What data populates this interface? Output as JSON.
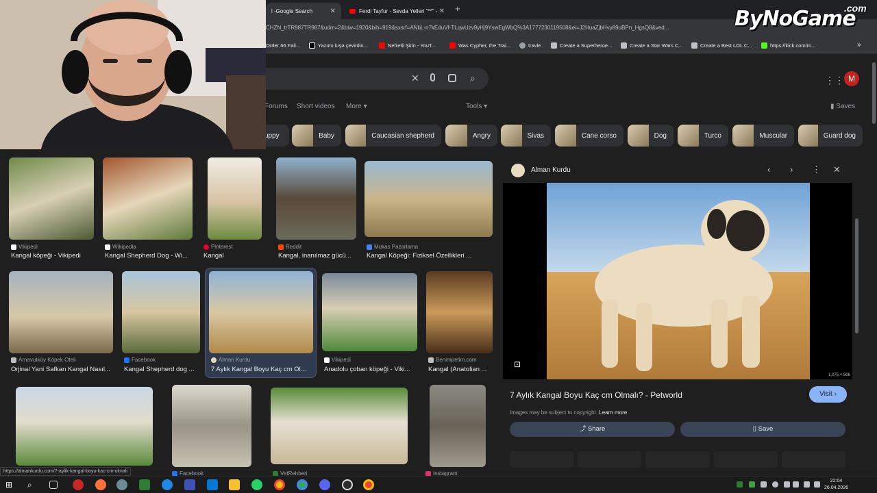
{
  "tabs": [
    {
      "title": "Google Search",
      "prefix": "l - "
    },
    {
      "title": "Ferdi Tayfur - Sevda Yelleri \"**\" -"
    }
  ],
  "url": "CHZN_trTR987TR987&udm=2&biw=1920&bih=919&sxsrf=ANbL-n7kEduVf-TLqwUzv9yHj9YswEgWbQ%3A1777230119508&ei=J2HuaZjbHvy89uBPn_HgsQ8&ved...",
  "bookmarks": [
    "Order 66 Fail...",
    "Yazımı kışa çevirdin...",
    "Nefretli Şirin - YouT...",
    "Was Cypher, the Trai...",
    "travle",
    "Create a Superheroe...",
    "Create a Star Wars C...",
    "Create a Best LOL C...",
    "https://kick.com/m..."
  ],
  "logo": {
    "main": "ByNoGame",
    "suffix": ".com"
  },
  "avatar_letter": "M",
  "nav": {
    "forums": "Forums",
    "short_videos": "Short videos",
    "more": "More",
    "tools": "Tools",
    "saves": "Saves"
  },
  "chips": [
    "uppy",
    "Baby",
    "Caucasian shepherd",
    "Angry",
    "Sivas",
    "Cane corso",
    "Dog",
    "Turco",
    "Muscular",
    "Guard dog"
  ],
  "results": [
    {
      "source": "Vikipedi",
      "caption": "Kangal köpeği - Vikipedi"
    },
    {
      "source": "Wikipedia",
      "caption": "Kangal Shepherd Dog - Wi..."
    },
    {
      "source": "Pinterest",
      "caption": "Kangal"
    },
    {
      "source": "Reddit",
      "caption": "Kangal, inanılmaz gücü..."
    },
    {
      "source": "Mukas Pazarlama",
      "caption": "Kangal Köpeği: Fiziksel Özellikleri ..."
    },
    {
      "source": "Arnavutköy Köpek Oteli",
      "caption": "Orjinal Yani Safkan Kangal Nasıl..."
    },
    {
      "source": "Facebook",
      "caption": "Kangal Shepherd dog ..."
    },
    {
      "source": "Alman Kurdu",
      "caption": "7 Aylık Kangal Boyu Kaç cm Ol..."
    },
    {
      "source": "Vikipedi",
      "caption": "Anadolu çoban köpeği - Viki..."
    },
    {
      "source": "Benimpetim.com",
      "caption": "Kangal (Anatolian ..."
    },
    {
      "source": "",
      "caption": ""
    },
    {
      "source": "Facebook",
      "caption": ""
    },
    {
      "source": "VetRehberi",
      "caption": ""
    },
    {
      "source": "Instagram",
      "caption": ""
    }
  ],
  "preview": {
    "site": "Alman Kurdu",
    "dims": "1,075 × 806",
    "title": "7 Aylık Kangal Boyu Kaç cm Olmalı? - Petworld",
    "visit": "Visit",
    "copyright": "Images may be subject to copyright.",
    "learn_more": "Learn more",
    "share": "Share",
    "save": "Save"
  },
  "status_url": "https://almankurdu.com/7-aylik-kangal-boyu-kac-cm-olmali",
  "clock": {
    "time": "22:04",
    "date": "26.04.2026"
  },
  "colors": {
    "accent": "#8ab4f8",
    "page_bg": "#1f1f1f",
    "avatar": "#c5221f"
  }
}
